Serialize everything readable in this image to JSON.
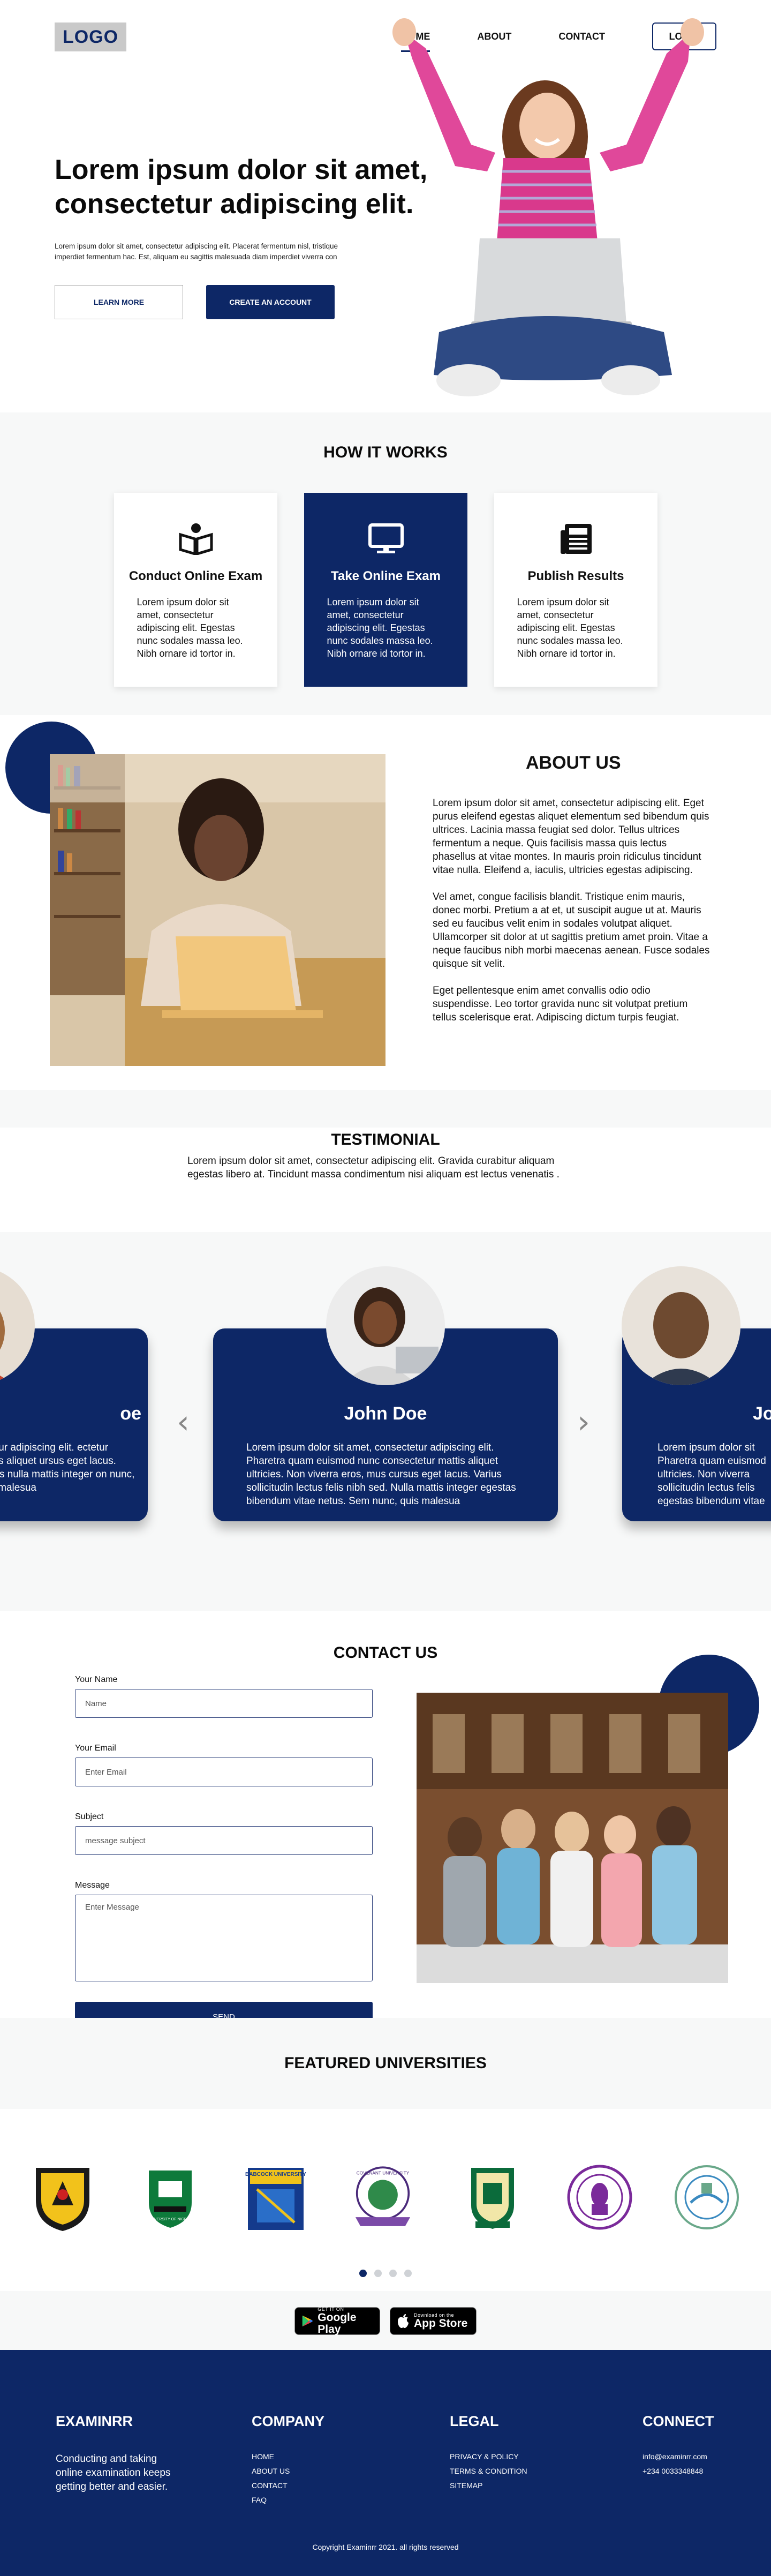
{
  "header": {
    "logo": "LOGO",
    "nav": [
      "HOME",
      "ABOUT",
      "CONTACT"
    ],
    "login": "LOGIN"
  },
  "hero": {
    "title": "Lorem ipsum dolor sit amet, consectetur adipiscing elit.",
    "subtitle": "Lorem ipsum dolor sit amet, consectetur adipiscing elit. Placerat fermentum nisl, tristique imperdiet fermentum hac. Est, aliquam eu sagittis malesuada diam imperdiet viverra con",
    "learn_more": "LEARN MORE",
    "create_account": "CREATE AN ACCOUNT"
  },
  "how": {
    "title": "HOW IT WORKS",
    "cards": [
      {
        "title": "Conduct Online Exam",
        "text": "Lorem ipsum dolor sit amet, consectetur adipiscing elit. Egestas nunc sodales massa leo. Nibh ornare id tortor in.",
        "icon": "book-reader-icon"
      },
      {
        "title": "Take Online Exam",
        "text": "Lorem ipsum dolor sit amet, consectetur adipiscing elit. Egestas nunc sodales massa leo. Nibh ornare id tortor in.",
        "icon": "monitor-icon"
      },
      {
        "title": "Publish Results",
        "text": "Lorem ipsum dolor sit amet, consectetur adipiscing elit. Egestas nunc sodales massa leo. Nibh ornare id tortor in.",
        "icon": "newspaper-icon"
      }
    ]
  },
  "about": {
    "title": "ABOUT US",
    "paragraphs": [
      "Lorem ipsum dolor sit amet, consectetur adipiscing elit. Eget purus eleifend egestas aliquet elementum sed bibendum quis ultrices. Lacinia massa feugiat sed dolor. Tellus ultrices fermentum a neque. Quis facilisis massa quis lectus phasellus at vitae montes. In mauris proin ridiculus tincidunt vitae nulla. Eleifend a, iaculis, ultricies egestas adipiscing.",
      "Vel amet, congue facilisis blandit. Tristique enim mauris, donec morbi. Pretium a at et, ut suscipit augue ut at. Mauris sed eu faucibus velit enim in sodales volutpat aliquet. Ullamcorper sit dolor at ut sagittis pretium amet proin. Vitae a neque faucibus nibh morbi maecenas aenean. Fusce sodales quisque sit velit.",
      "Eget pellentesque enim amet convallis odio odio suspendisse. Leo tortor gravida nunc sit volutpat pretium tellus scelerisque erat. Adipiscing dictum turpis feugiat."
    ]
  },
  "testimonial": {
    "title": "TESTIMONIAL",
    "intro": "Lorem ipsum dolor sit amet, consectetur adipiscing elit. Gravida curabitur aliquam egestas libero at. Tincidunt massa condimentum nisi aliquam est lectus venenatis .",
    "cards": [
      {
        "name": "oe",
        "text": "ectetur adipiscing elit. ectetur mattis aliquet ursus eget lacus. Varius nulla mattis integer on nunc, quis malesua"
      },
      {
        "name": "John Doe",
        "text": "Lorem ipsum dolor sit amet, consectetur adipiscing elit. Pharetra quam euismod nunc consectetur mattis aliquet ultricies. Non viverra eros, mus cursus eget lacus. Varius sollicitudin lectus felis nibh sed. Nulla mattis integer egestas bibendum vitae netus. Sem nunc, quis malesua"
      },
      {
        "name": "Jo",
        "text": "Lorem ipsum dolor sit Pharetra quam euismod ultricies. Non viverra sollicitudin lectus felis egestas bibendum vitae"
      }
    ]
  },
  "contact": {
    "title": "CONTACT US",
    "name_label": "Your Name",
    "name_placeholder": "Name",
    "email_label": "Your Email",
    "email_placeholder": "Enter Email",
    "subject_label": "Subject",
    "subject_placeholder": "message subject",
    "message_label": "Message",
    "message_placeholder": "Enter Message",
    "send": "SEND"
  },
  "featured": {
    "title": "FEATURED UNIVERSITIES",
    "babcock": "BABCOCK UNIVERSITY",
    "covenant": "COVENANT UNIVERSITY"
  },
  "stores": {
    "google_small": "GET IT ON",
    "google_big": "Google Play",
    "apple_small": "Download on the",
    "apple_big": "App Store"
  },
  "footer": {
    "brand": "EXAMINRR",
    "description": "Conducting and taking online examination keeps getting better and easier.",
    "company_title": "COMPANY",
    "company_links": [
      "HOME",
      "ABOUT US",
      "CONTACT",
      "FAQ"
    ],
    "legal_title": "LEGAL",
    "legal_links": [
      "PRIVACY & POLICY",
      "TERMS & CONDITION",
      "SITEMAP"
    ],
    "connect_title": "CONNECT",
    "connect_links": [
      "info@examinrr.com",
      "+234 0033348848"
    ],
    "copyright": "Copyright   Examinrr 2021.   all rights reserved"
  },
  "colors": {
    "brand": "#0d2766",
    "muted_bg": "#f7f8f8"
  }
}
